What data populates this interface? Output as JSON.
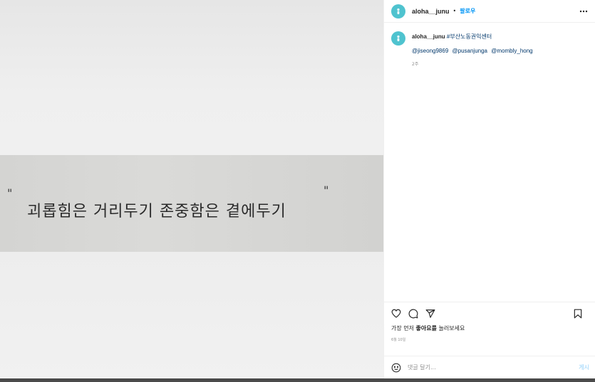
{
  "post": {
    "username": "aloha__junu",
    "follow_label": "팔로우",
    "separator": "•",
    "caption_hashtag": "#부산노동권익센터",
    "mentions": [
      "@jiseong9869",
      "@pusanjunga",
      "@mombly_hong"
    ],
    "time_ago": "2주",
    "likes_prefix": "가장 먼저 ",
    "likes_bold": "좋아요를",
    "likes_suffix": " 눌러보세요",
    "date": "6월 10일"
  },
  "image": {
    "quote_open": "\"",
    "quote_close": "\"",
    "handwriting_text": "괴롭힘은 거리두기 존중함은 곁에두기"
  },
  "comment_box": {
    "placeholder": "댓글 달기...",
    "post_label": "게시"
  },
  "colors": {
    "avatar": "#4fc3cf",
    "link": "#00376b",
    "follow": "#0095f6",
    "post_disabled": "#b2dffc"
  },
  "icons": {
    "more": "more-horizontal-icon",
    "like": "heart-icon",
    "comment": "comment-icon",
    "share": "share-icon",
    "save": "bookmark-icon",
    "emoji": "emoji-icon"
  }
}
